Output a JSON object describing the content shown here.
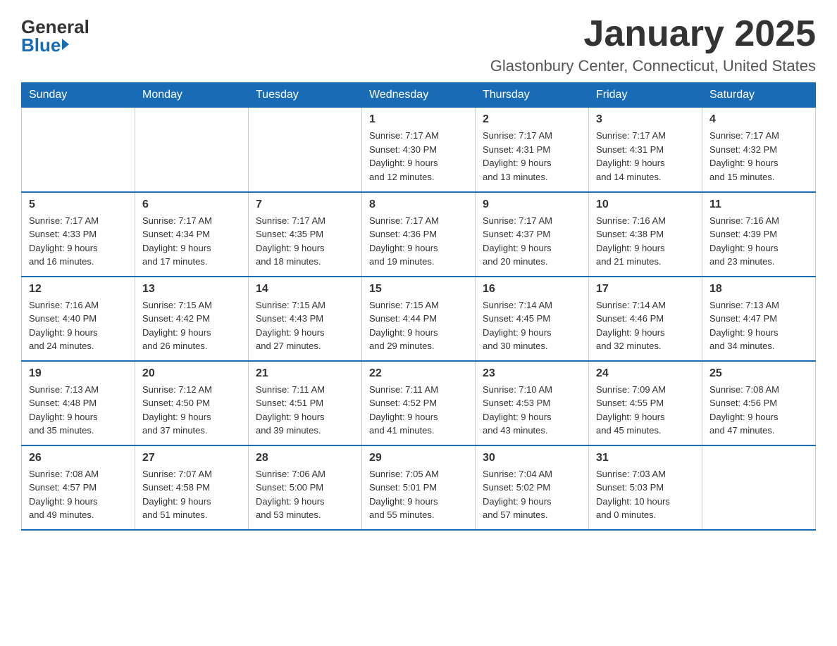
{
  "header": {
    "logo_general": "General",
    "logo_blue": "Blue",
    "month_year": "January 2025",
    "location": "Glastonbury Center, Connecticut, United States"
  },
  "weekdays": [
    "Sunday",
    "Monday",
    "Tuesday",
    "Wednesday",
    "Thursday",
    "Friday",
    "Saturday"
  ],
  "weeks": [
    [
      {
        "day": "",
        "info": ""
      },
      {
        "day": "",
        "info": ""
      },
      {
        "day": "",
        "info": ""
      },
      {
        "day": "1",
        "info": "Sunrise: 7:17 AM\nSunset: 4:30 PM\nDaylight: 9 hours\nand 12 minutes."
      },
      {
        "day": "2",
        "info": "Sunrise: 7:17 AM\nSunset: 4:31 PM\nDaylight: 9 hours\nand 13 minutes."
      },
      {
        "day": "3",
        "info": "Sunrise: 7:17 AM\nSunset: 4:31 PM\nDaylight: 9 hours\nand 14 minutes."
      },
      {
        "day": "4",
        "info": "Sunrise: 7:17 AM\nSunset: 4:32 PM\nDaylight: 9 hours\nand 15 minutes."
      }
    ],
    [
      {
        "day": "5",
        "info": "Sunrise: 7:17 AM\nSunset: 4:33 PM\nDaylight: 9 hours\nand 16 minutes."
      },
      {
        "day": "6",
        "info": "Sunrise: 7:17 AM\nSunset: 4:34 PM\nDaylight: 9 hours\nand 17 minutes."
      },
      {
        "day": "7",
        "info": "Sunrise: 7:17 AM\nSunset: 4:35 PM\nDaylight: 9 hours\nand 18 minutes."
      },
      {
        "day": "8",
        "info": "Sunrise: 7:17 AM\nSunset: 4:36 PM\nDaylight: 9 hours\nand 19 minutes."
      },
      {
        "day": "9",
        "info": "Sunrise: 7:17 AM\nSunset: 4:37 PM\nDaylight: 9 hours\nand 20 minutes."
      },
      {
        "day": "10",
        "info": "Sunrise: 7:16 AM\nSunset: 4:38 PM\nDaylight: 9 hours\nand 21 minutes."
      },
      {
        "day": "11",
        "info": "Sunrise: 7:16 AM\nSunset: 4:39 PM\nDaylight: 9 hours\nand 23 minutes."
      }
    ],
    [
      {
        "day": "12",
        "info": "Sunrise: 7:16 AM\nSunset: 4:40 PM\nDaylight: 9 hours\nand 24 minutes."
      },
      {
        "day": "13",
        "info": "Sunrise: 7:15 AM\nSunset: 4:42 PM\nDaylight: 9 hours\nand 26 minutes."
      },
      {
        "day": "14",
        "info": "Sunrise: 7:15 AM\nSunset: 4:43 PM\nDaylight: 9 hours\nand 27 minutes."
      },
      {
        "day": "15",
        "info": "Sunrise: 7:15 AM\nSunset: 4:44 PM\nDaylight: 9 hours\nand 29 minutes."
      },
      {
        "day": "16",
        "info": "Sunrise: 7:14 AM\nSunset: 4:45 PM\nDaylight: 9 hours\nand 30 minutes."
      },
      {
        "day": "17",
        "info": "Sunrise: 7:14 AM\nSunset: 4:46 PM\nDaylight: 9 hours\nand 32 minutes."
      },
      {
        "day": "18",
        "info": "Sunrise: 7:13 AM\nSunset: 4:47 PM\nDaylight: 9 hours\nand 34 minutes."
      }
    ],
    [
      {
        "day": "19",
        "info": "Sunrise: 7:13 AM\nSunset: 4:48 PM\nDaylight: 9 hours\nand 35 minutes."
      },
      {
        "day": "20",
        "info": "Sunrise: 7:12 AM\nSunset: 4:50 PM\nDaylight: 9 hours\nand 37 minutes."
      },
      {
        "day": "21",
        "info": "Sunrise: 7:11 AM\nSunset: 4:51 PM\nDaylight: 9 hours\nand 39 minutes."
      },
      {
        "day": "22",
        "info": "Sunrise: 7:11 AM\nSunset: 4:52 PM\nDaylight: 9 hours\nand 41 minutes."
      },
      {
        "day": "23",
        "info": "Sunrise: 7:10 AM\nSunset: 4:53 PM\nDaylight: 9 hours\nand 43 minutes."
      },
      {
        "day": "24",
        "info": "Sunrise: 7:09 AM\nSunset: 4:55 PM\nDaylight: 9 hours\nand 45 minutes."
      },
      {
        "day": "25",
        "info": "Sunrise: 7:08 AM\nSunset: 4:56 PM\nDaylight: 9 hours\nand 47 minutes."
      }
    ],
    [
      {
        "day": "26",
        "info": "Sunrise: 7:08 AM\nSunset: 4:57 PM\nDaylight: 9 hours\nand 49 minutes."
      },
      {
        "day": "27",
        "info": "Sunrise: 7:07 AM\nSunset: 4:58 PM\nDaylight: 9 hours\nand 51 minutes."
      },
      {
        "day": "28",
        "info": "Sunrise: 7:06 AM\nSunset: 5:00 PM\nDaylight: 9 hours\nand 53 minutes."
      },
      {
        "day": "29",
        "info": "Sunrise: 7:05 AM\nSunset: 5:01 PM\nDaylight: 9 hours\nand 55 minutes."
      },
      {
        "day": "30",
        "info": "Sunrise: 7:04 AM\nSunset: 5:02 PM\nDaylight: 9 hours\nand 57 minutes."
      },
      {
        "day": "31",
        "info": "Sunrise: 7:03 AM\nSunset: 5:03 PM\nDaylight: 10 hours\nand 0 minutes."
      },
      {
        "day": "",
        "info": ""
      }
    ]
  ]
}
